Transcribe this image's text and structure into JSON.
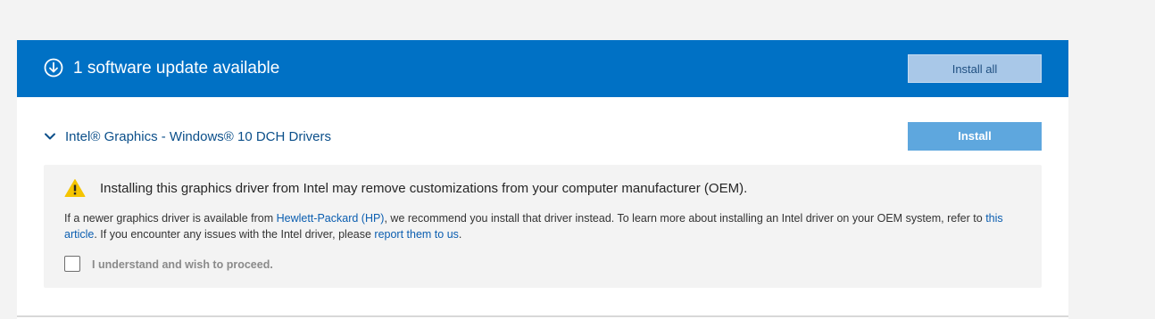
{
  "header": {
    "icon": "download-circle-icon",
    "title": "1 software update available",
    "install_all_label": "Install all",
    "background": "#0071c5"
  },
  "update_item": {
    "expand_icon": "chevron-down-icon",
    "title": "Intel® Graphics - Windows® 10 DCH Drivers",
    "install_label": "Install"
  },
  "warning": {
    "icon": "warning-triangle-icon",
    "icon_color": "#f5c400",
    "title": "Installing this graphics driver from Intel may remove customizations from your computer manufacturer (OEM).",
    "body_part1": "If a newer graphics driver is available from ",
    "oem_link": "Hewlett-Packard (HP)",
    "body_part2": ", we recommend you install that driver instead. To learn more about installing an Intel driver on your OEM system, refer to ",
    "article_link": "this article",
    "body_part3": ". If you encounter any issues with the Intel driver, please ",
    "report_link": "report them to us",
    "body_part4": ".",
    "checkbox_label": "I understand and wish to proceed.",
    "checkbox_checked": false
  }
}
